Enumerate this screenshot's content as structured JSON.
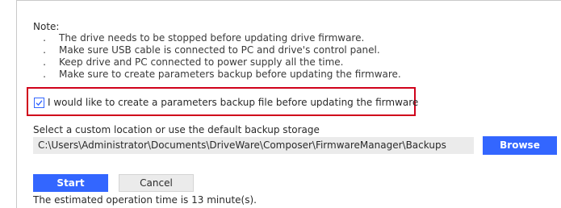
{
  "note": {
    "title": "Note:",
    "bullets": [
      "The drive needs to be stopped before updating drive firmware.",
      "Make sure USB cable is connected to PC and drive's control panel.",
      "Keep drive and PC connected to power supply all the time.",
      "Make sure to create parameters backup before updating the firmware."
    ],
    "bullet_glyph": "."
  },
  "backup_option": {
    "label": "I would like to create a parameters backup file before updating the firmware",
    "checked": true,
    "highlight_color": "#d0021b"
  },
  "location": {
    "label": "Select a custom location or use the default backup storage",
    "path": "C:\\Users\\Administrator\\Documents\\DriveWare\\Composer\\FirmwareManager\\Backups",
    "browse_label": "Browse"
  },
  "actions": {
    "start_label": "Start",
    "cancel_label": "Cancel"
  },
  "estimate": {
    "text": "The estimated operation time is 13 minute(s)."
  },
  "colors": {
    "accent": "#3366ff",
    "field_bg": "#ebebeb"
  }
}
